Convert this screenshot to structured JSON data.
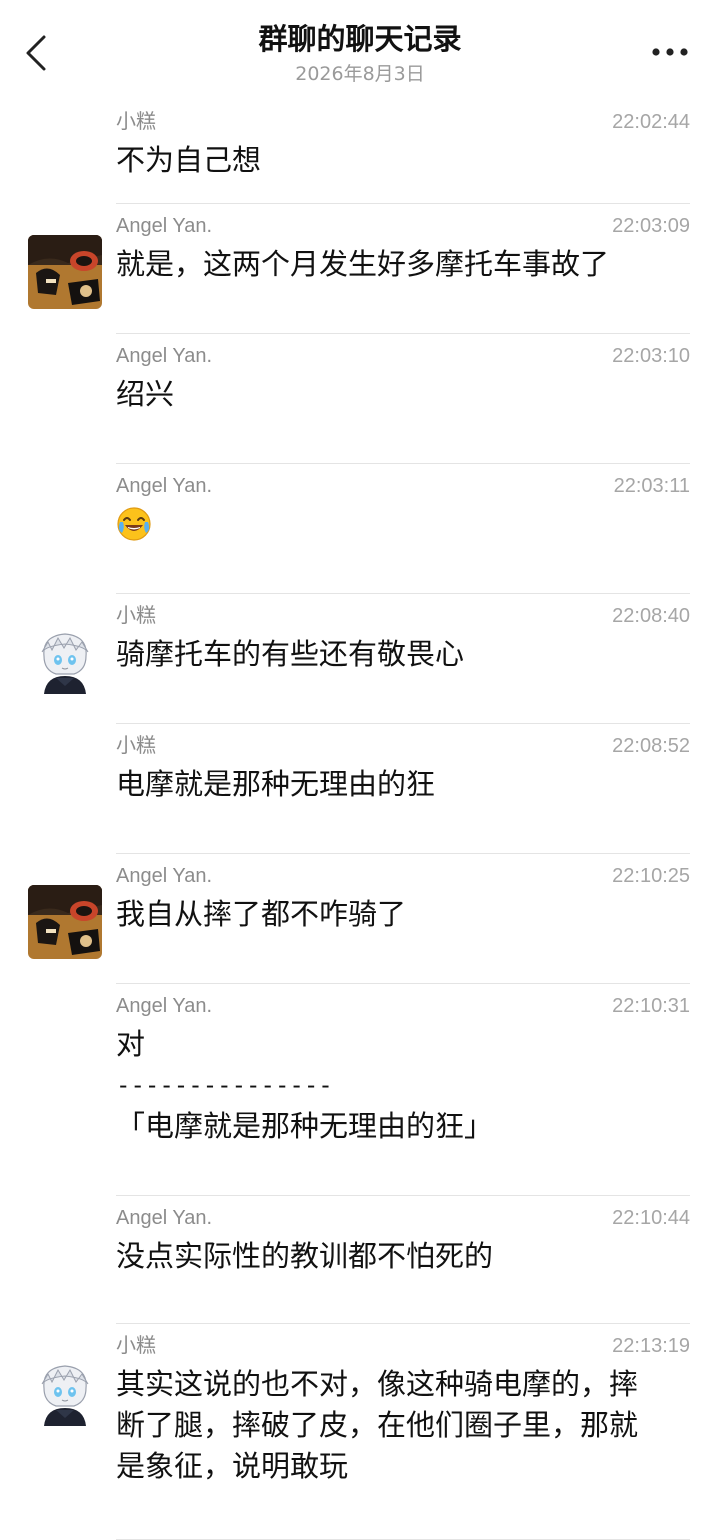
{
  "header": {
    "title": "群聊的聊天记录",
    "date": "2026年8月3日",
    "back_icon": "chevron-left-icon",
    "more_icon": "more-horizontal-icon"
  },
  "messages": [
    {
      "sender": "小糕",
      "time": "22:02:44",
      "text": "不为自己想"
    },
    {
      "sender": "Angel Yan.",
      "time": "22:03:09",
      "text": "就是，这两个月发生好多摩托车事故了"
    },
    {
      "sender": "Angel Yan.",
      "time": "22:03:10",
      "text": "绍兴"
    },
    {
      "sender": "Angel Yan.",
      "time": "22:03:11",
      "emoji": "crying-laughing-emoji"
    },
    {
      "sender": "小糕",
      "time": "22:08:40",
      "text": "骑摩托车的有些还有敬畏心"
    },
    {
      "sender": "小糕",
      "time": "22:08:52",
      "text": "电摩就是那种无理由的狂"
    },
    {
      "sender": "Angel Yan.",
      "time": "22:10:25",
      "text": "我自从摔了都不咋骑了"
    },
    {
      "sender": "Angel Yan.",
      "time": "22:10:31",
      "text": "对",
      "quote_separator": "---------------",
      "quote": "「电摩就是那种无理由的狂」"
    },
    {
      "sender": "Angel Yan.",
      "time": "22:10:44",
      "text": "没点实际性的教训都不怕死的"
    },
    {
      "sender": "小糕",
      "time": "22:13:19",
      "lines": [
        "其实这说的也不对，像这种骑电摩的，摔",
        "断了腿，摔破了皮，在他们圈子里，那就",
        "是象征，说明敢玩"
      ]
    }
  ]
}
